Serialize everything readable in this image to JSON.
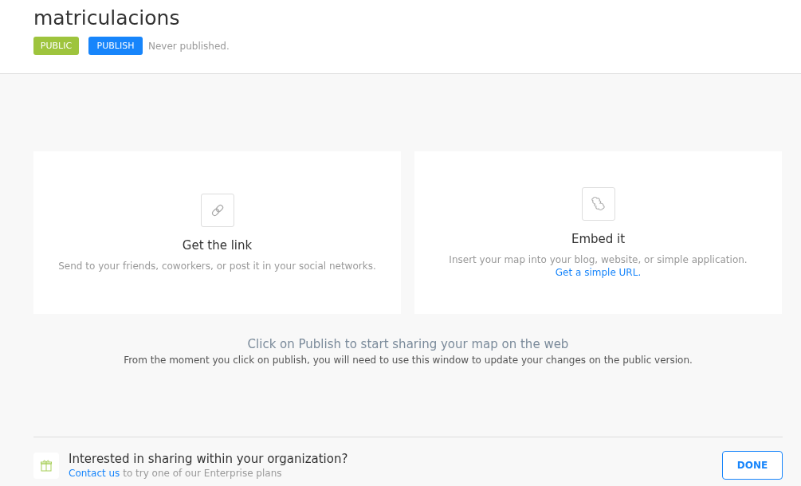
{
  "header": {
    "title": "matriculacions",
    "badge": "PUBLIC",
    "publish_button": "PUBLISH",
    "status": "Never published."
  },
  "cards": [
    {
      "kind": "link",
      "title": "Get the link",
      "description": "Send to your friends, coworkers, or post it in your social networks."
    },
    {
      "kind": "embed",
      "title": "Embed it",
      "description": "Insert your map into your blog, website, or simple application.",
      "link": "Get a simple URL."
    }
  ],
  "notice": {
    "title": "Click on Publish to start sharing your map on the web",
    "text": "From the moment you click on publish, you will need to use this window to update your changes on the public version."
  },
  "footer": {
    "title": "Interested in sharing within your organization?",
    "link": "Contact us",
    "text": " to try one of our Enterprise plans",
    "button": "DONE"
  }
}
